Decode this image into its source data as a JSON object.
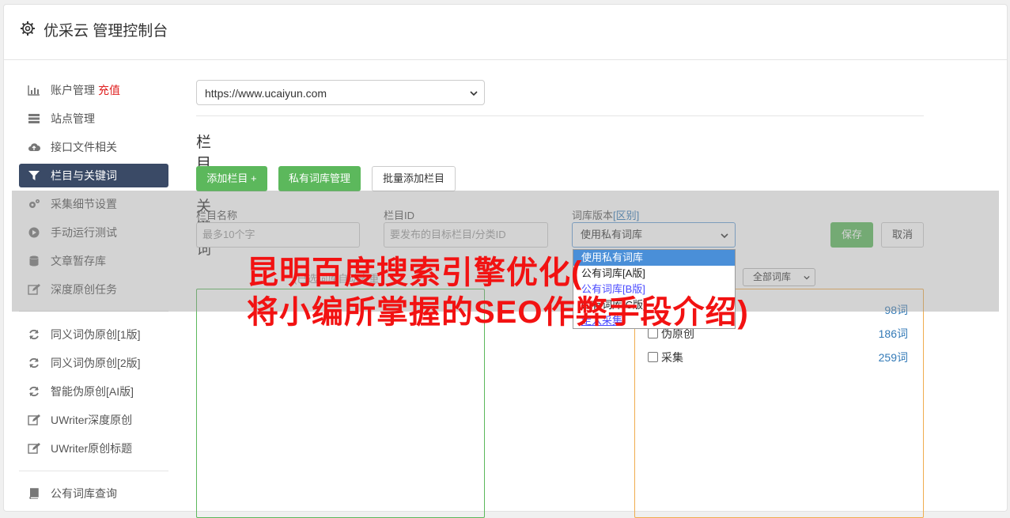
{
  "header": {
    "title": "优采云 管理控制台",
    "icon": "gear-icon"
  },
  "sidebar": {
    "items": [
      {
        "label": "账户管理",
        "badge": "充值",
        "icon": "bar-chart-icon"
      },
      {
        "label": "站点管理",
        "icon": "server-icon"
      },
      {
        "label": "接口文件相关",
        "icon": "cloud-upload-icon"
      },
      {
        "label": "栏目与关键词",
        "icon": "filter-icon",
        "active": true
      },
      {
        "label": "采集细节设置",
        "icon": "cogs-icon"
      },
      {
        "label": "手动运行测试",
        "icon": "play-circle-icon"
      },
      {
        "label": "文章暂存库",
        "icon": "database-icon"
      },
      {
        "label": "深度原创任务",
        "icon": "edit-icon"
      },
      {
        "label": "同义词伪原创[1版]",
        "icon": "refresh-icon"
      },
      {
        "label": "同义词伪原创[2版]",
        "icon": "refresh-icon"
      },
      {
        "label": "智能伪原创[AI版]",
        "icon": "refresh-icon"
      },
      {
        "label": "UWriter深度原创",
        "icon": "edit-icon"
      },
      {
        "label": "UWriter原创标题",
        "icon": "edit-icon"
      },
      {
        "label": "公有词库查询",
        "icon": "book-icon"
      }
    ]
  },
  "main": {
    "site_select": "https://www.ucaiyun.com",
    "section_title": "栏目与关键词",
    "buttons": {
      "add_column": "添加栏目 +",
      "private_lib": "私有词库管理",
      "batch_add": "批量添加栏目"
    },
    "form": {
      "name_label": "栏目名称",
      "name_placeholder": "最多10个字",
      "id_label": "栏目ID",
      "id_placeholder": "要发布的目标栏目/分类ID",
      "lib_label": "词库版本",
      "lib_label_link": "[区别]",
      "lib_value": "使用私有词库",
      "save": "保存",
      "cancel": "取消"
    },
    "dropdown_options": [
      "使用私有词库",
      "公有词库[A版]",
      "公有词库[B版]",
      "公有词库[C版]",
      "走入采集"
    ],
    "left_box_label": "(已选词库自动去重",
    "lib_filter": "全部词库",
    "libraries": [
      {
        "name": "",
        "count": "98词"
      },
      {
        "name": "伪原创",
        "count": "186词"
      },
      {
        "name": "采集",
        "count": "259词"
      }
    ]
  },
  "watermark": {
    "line1": "昆明百度搜索引擎优化(",
    "line2": "将小编所掌握的SEO作弊手段介绍)"
  },
  "colors": {
    "active_nav": "#3a4a66",
    "green": "#5cb85c",
    "orange_border": "#f0ad4e",
    "recharge_red": "#e02020",
    "watermark_red": "#f21212"
  }
}
